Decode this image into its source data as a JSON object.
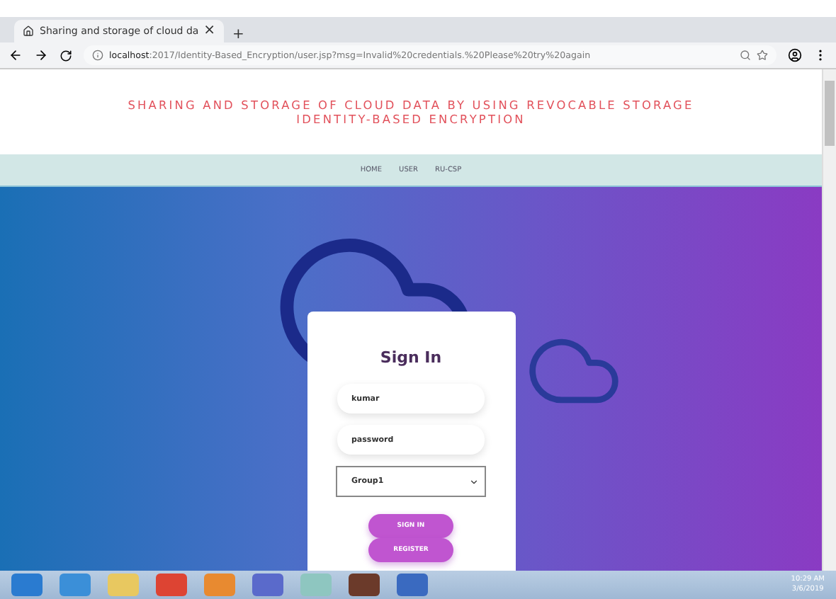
{
  "browser": {
    "tab_title": "Sharing and storage of cloud da",
    "tab_close": "×",
    "new_tab": "+",
    "url_host": "localhost",
    "url_path": ":2017/Identity-Based_Encryption/user.jsp?msg=Invalid%20credentials.%20Please%20try%20again"
  },
  "page": {
    "title_lines": [
      "SHARING AND STORAGE OF CLOUD DATA BY USING REVOCABLE STORAGE",
      "IDENTITY-BASED ENCRYPTION"
    ],
    "nav": [
      {
        "label": "HOME"
      },
      {
        "label": "USER"
      },
      {
        "label": "RU-CSP"
      }
    ],
    "login": {
      "heading": "Sign In",
      "username": {
        "value": "kumar"
      },
      "password": {
        "placeholder": "password"
      },
      "group": {
        "value": "Group1"
      },
      "buttons": [
        "SIGN IN",
        "REGISTER"
      ]
    }
  },
  "taskbar": {
    "time": "10:29 AM",
    "date": "3/6/2019"
  }
}
